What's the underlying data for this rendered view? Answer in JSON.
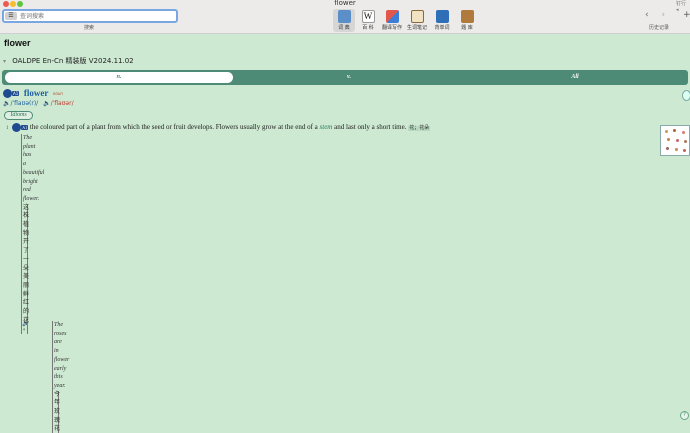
{
  "window": {
    "title": "flower",
    "collapse_label": "钉行 ◂"
  },
  "search": {
    "mode_label": "☰",
    "placeholder": "查词搜索",
    "caption": "搜索"
  },
  "toolbar": {
    "buttons": [
      {
        "label": "词 典",
        "icon": "dictionary-icon"
      },
      {
        "label": "百 科",
        "icon": "wikipedia-icon"
      },
      {
        "label": "翻译写作",
        "icon": "translate-icon"
      },
      {
        "label": "生词笔记",
        "icon": "notebook-icon"
      },
      {
        "label": "背单词",
        "icon": "book-icon"
      },
      {
        "label": "题 库",
        "icon": "question-bank-icon"
      }
    ],
    "back": "‹",
    "forward": "›",
    "history_label": "历史记录",
    "add": "+"
  },
  "entry": {
    "word": "flower",
    "dictionary": "OALDPE En-Cn 精装版 V2024.11.02",
    "pos_tabs": [
      "n.",
      "v.",
      "All"
    ],
    "headword": "flower",
    "level": "A1",
    "pos": "noun",
    "pron_br": "/ˈflaʊə(r)/",
    "pron_am": "/ˈflaʊər/",
    "idioms_label": "Idioms",
    "sense": {
      "number": "1",
      "level": "A1",
      "definition_pre": "the coloured part of a plant from which the seed or fruit develops. Flowers usually grow at the end of a",
      "xref": "stem",
      "definition_post": "and last only a short time.",
      "translation": "花；花朵"
    },
    "examples": [
      {
        "en_words": [
          "The",
          "plant",
          "has",
          "a",
          "beautiful",
          "bright",
          "red",
          "flower."
        ],
        "zh_chars": [
          "这",
          "株",
          "植",
          "物",
          "开",
          "了",
          "一",
          "朵",
          "美",
          "丽",
          "鲜",
          "红",
          "的",
          "花",
          "。"
        ]
      },
      {
        "en_words": [
          "The",
          "roses",
          "are",
          "in",
          "flower",
          "early",
          "this",
          "year."
        ],
        "zh_chars": [
          "今",
          "年",
          "玫",
          "瑰",
          "花"
        ]
      }
    ]
  },
  "colors": {
    "background": "#cde9d2",
    "pos_bar": "#4e8b76",
    "headword": "#1a5fa0",
    "am_pron": "#c0392b"
  }
}
